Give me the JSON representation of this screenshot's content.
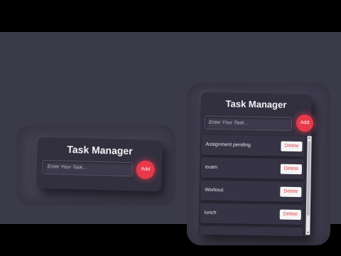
{
  "small_card": {
    "title": "Task Manager",
    "input_placeholder": "Enter Your Task...",
    "add_label": "Add"
  },
  "large_card": {
    "title": "Task Manager",
    "input_placeholder": "Enter Your Task...",
    "add_label": "Add",
    "tasks": [
      {
        "text": "Assignment pending",
        "delete_label": "Delete"
      },
      {
        "text": "exam",
        "delete_label": "Delete"
      },
      {
        "text": "Workout",
        "delete_label": "Delete"
      },
      {
        "text": "lunch",
        "delete_label": "Delete"
      }
    ],
    "scrollbar": {
      "up_icon": "▲",
      "down_icon": "▼"
    }
  },
  "colors": {
    "background": "#3b3a48",
    "card": "#32303f",
    "accent": "#e8384a"
  }
}
